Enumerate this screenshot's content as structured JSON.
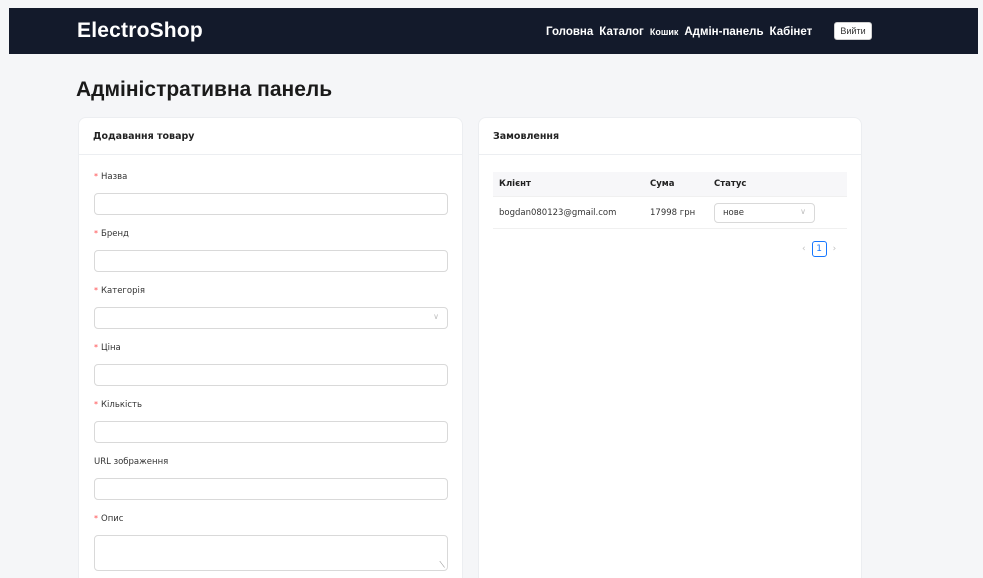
{
  "nav": {
    "logo": "ElectroShop",
    "links": [
      "Головна",
      "Каталог",
      "Кошик",
      "Адмін-панель",
      "Кабінет"
    ],
    "logout": "Вийти"
  },
  "page_title": "Адміністративна панель",
  "add_product": {
    "title": "Додавання товару",
    "fields": {
      "name": {
        "label": "Назва",
        "value": ""
      },
      "brand": {
        "label": "Бренд",
        "value": ""
      },
      "category": {
        "label": "Категорія",
        "value": ""
      },
      "price": {
        "label": "Ціна",
        "value": ""
      },
      "quantity": {
        "label": "Кількість",
        "value": ""
      },
      "image_url": {
        "label": "URL зображення",
        "value": ""
      },
      "description": {
        "label": "Опис",
        "value": ""
      }
    }
  },
  "orders": {
    "title": "Замовлення",
    "columns": [
      "Клієнт",
      "Сума",
      "Статус"
    ],
    "rows": [
      {
        "client": "bogdan080123@gmail.com",
        "sum": "17998 грн",
        "status": "нове"
      }
    ],
    "pagination": {
      "current": "1"
    }
  },
  "icons": {
    "chevron": "chevron-down-icon",
    "prev": "chevron-left-icon",
    "next": "chevron-right-icon"
  }
}
